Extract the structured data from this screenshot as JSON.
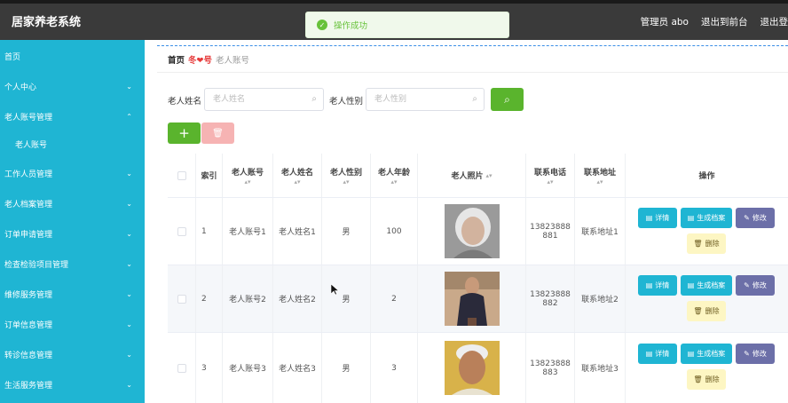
{
  "app": {
    "title": "居家养老系统"
  },
  "toast": {
    "message": "操作成功"
  },
  "header": {
    "user": "管理员 abo",
    "back_to_front": "退出到前台",
    "logout": "退出登"
  },
  "sidebar": {
    "items": [
      {
        "label": "首页",
        "expandable": false
      },
      {
        "label": "个人中心",
        "expandable": true
      },
      {
        "label": "老人账号管理",
        "expandable": true,
        "expanded": true
      },
      {
        "label": "老人账号",
        "sub": true
      },
      {
        "label": "工作人员管理",
        "expandable": true
      },
      {
        "label": "老人档案管理",
        "expandable": true
      },
      {
        "label": "订单申请管理",
        "expandable": true
      },
      {
        "label": "检查检验项目管理",
        "expandable": true
      },
      {
        "label": "维修服务管理",
        "expandable": true
      },
      {
        "label": "订单信息管理",
        "expandable": true
      },
      {
        "label": "转诊信息管理",
        "expandable": true
      },
      {
        "label": "生活服务管理",
        "expandable": true
      }
    ]
  },
  "breadcrumb": {
    "home": "首页",
    "separator": "冬❤号",
    "current": "老人账号"
  },
  "filters": {
    "name_label": "老人姓名",
    "name_placeholder": "老人姓名",
    "gender_label": "老人性别",
    "gender_placeholder": "老人性别"
  },
  "table": {
    "headers": [
      "索引",
      "老人账号",
      "老人姓名",
      "老人性别",
      "老人年龄",
      "老人照片",
      "联系电话",
      "联系地址",
      "操作"
    ],
    "rows": [
      {
        "index": "1",
        "account": "老人账号1",
        "name": "老人姓名1",
        "gender": "男",
        "age": "100",
        "phone_a": "13823888",
        "phone_b": "881",
        "address": "联系地址1"
      },
      {
        "index": "2",
        "account": "老人账号2",
        "name": "老人姓名2",
        "gender": "男",
        "age": "2",
        "phone_a": "13823888",
        "phone_b": "882",
        "address": "联系地址2"
      },
      {
        "index": "3",
        "account": "老人账号3",
        "name": "老人姓名3",
        "gender": "男",
        "age": "3",
        "phone_a": "13823888",
        "phone_b": "883",
        "address": "联系地址3"
      }
    ],
    "actions": {
      "detail": "详情",
      "generate": "生成档案",
      "edit": "修改",
      "delete": "删除"
    }
  },
  "colors": {
    "sidebar": "#1fb5d3",
    "topbar": "#3a3a3a",
    "success": "#5ab42d",
    "edit": "#6c6fa8",
    "delete": "#fdf6c3"
  }
}
